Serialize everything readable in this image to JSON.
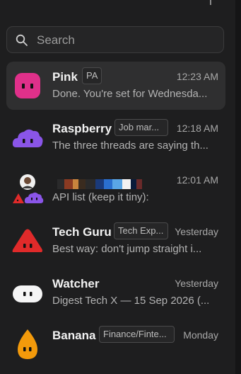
{
  "search": {
    "placeholder": "Search"
  },
  "conversations": [
    {
      "name": "Pink",
      "tag": "PA",
      "time": "12:23 AM",
      "preview": "Done. You're set for Wednesda...",
      "avatar": "pink-blob-icon",
      "active": true
    },
    {
      "name": "Raspberry",
      "tag": "Job mar...",
      "time": "12:18 AM",
      "preview": "The three threads are saying th...",
      "avatar": "purple-cloud-icon"
    },
    {
      "name": "",
      "tag": "",
      "time": "12:01 AM",
      "preview": "API list (keep it tiny):",
      "avatar": "group-avatar-icon"
    },
    {
      "name": "Tech Guru",
      "tag": "Tech Exp...",
      "time": "Yesterday",
      "preview": "Best way: don't jump straight i...",
      "avatar": "red-triangle-icon"
    },
    {
      "name": "Watcher",
      "tag": "",
      "time": "Yesterday",
      "preview": "Digest Tech X — 15 Sep 2026 (...",
      "avatar": "white-oval-icon"
    },
    {
      "name": "Banana",
      "tag": "Finance/Finte...",
      "time": "Monday",
      "preview": "",
      "avatar": "orange-drop-icon"
    }
  ],
  "colors": {
    "background": "#1e1e1f",
    "active_row": "#2f2f30",
    "pink": "#e0308a",
    "purple": "#8a55e8",
    "red": "#e02a2a",
    "orange": "#f39a0b"
  }
}
